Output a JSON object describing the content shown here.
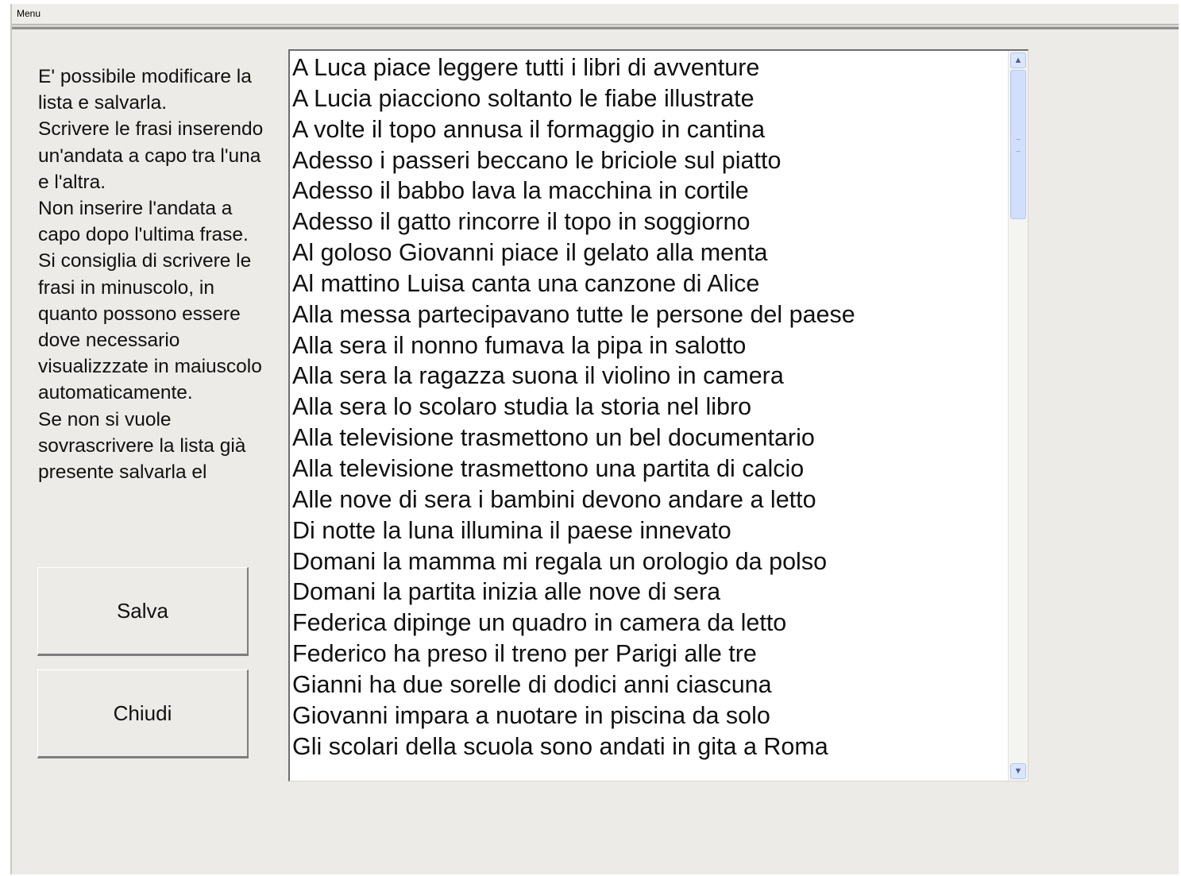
{
  "menubar": {
    "menu_label": "Menu"
  },
  "instructions": {
    "text": "E' possibile modificare la lista e salvarla.\nScrivere le frasi inserendo un'andata a capo tra l'una e l'altra.\nNon inserire l'andata a capo dopo l'ultima frase.\nSi consiglia di scrivere le frasi in minuscolo, in quanto possono essere dove necessario visualizzzate in maiuscolo automaticamente.\nSe non si vuole sovrascrivere la lista già presente salvarla el"
  },
  "buttons": {
    "save_label": "Salva",
    "close_label": "Chiudi"
  },
  "sentences": [
    "A Luca piace leggere tutti i libri di avventure",
    "A Lucia piacciono soltanto le fiabe illustrate",
    "A volte il topo annusa il formaggio in cantina",
    "Adesso i passeri beccano le briciole sul piatto",
    "Adesso il babbo lava la macchina in cortile",
    "Adesso il gatto rincorre il topo in soggiorno",
    "Al goloso Giovanni piace il gelato alla menta",
    "Al mattino Luisa canta una canzone di Alice",
    "Alla messa partecipavano tutte le persone del paese",
    "Alla sera il nonno fumava la pipa in salotto",
    "Alla sera la ragazza suona il violino in camera",
    "Alla sera lo scolaro studia la storia nel libro",
    "Alla televisione trasmettono un bel documentario",
    "Alla televisione trasmettono una partita di calcio",
    "Alle nove di sera i bambini devono andare a letto",
    "Di notte la luna illumina il paese innevato",
    "Domani la mamma mi regala un orologio da polso",
    "Domani la partita inizia alle nove di sera",
    "Federica dipinge un quadro in camera da letto",
    "Federico ha preso il treno per Parigi alle tre",
    "Gianni ha due sorelle di dodici anni ciascuna",
    "Giovanni impara a nuotare in piscina da solo",
    "Gli scolari della scuola sono andati in gita a Roma"
  ],
  "scrollbar": {
    "up_icon": "chevron-up-icon",
    "down_icon": "chevron-down-icon",
    "position_fraction": 0.0
  }
}
